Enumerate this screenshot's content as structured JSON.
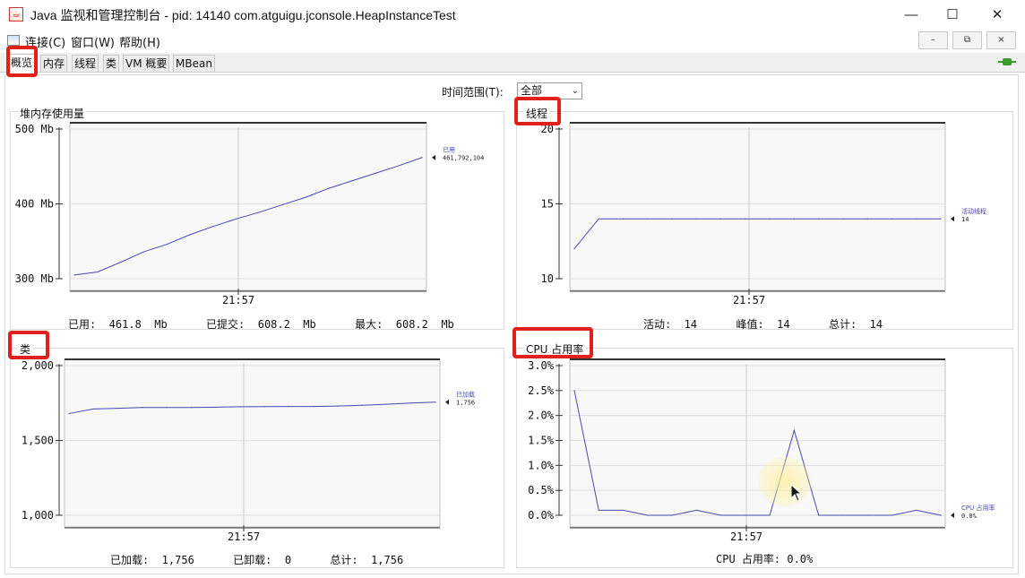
{
  "window": {
    "title": "Java 监视和管理控制台 - pid: 14140 com.atguigu.jconsole.HeapInstanceTest",
    "app_icon": "java-cup-icon",
    "controls": {
      "minimize": "—",
      "maximize": "☐",
      "close": "✕"
    }
  },
  "menu": [
    {
      "label": "连接(C)"
    },
    {
      "label": "窗口(W)"
    },
    {
      "label": "帮助(H)"
    }
  ],
  "inner_controls": {
    "minimize": "–",
    "restore": "⧉",
    "close": "×"
  },
  "tabs": [
    {
      "label": "概览",
      "active": true
    },
    {
      "label": "内存",
      "active": false
    },
    {
      "label": "线程",
      "active": false
    },
    {
      "label": "类",
      "active": false
    },
    {
      "label": "VM 概要",
      "active": false
    },
    {
      "label": "MBean",
      "active": false
    }
  ],
  "time_range": {
    "label": "时间范围(T):",
    "value": "全部"
  },
  "panels": {
    "heap": {
      "title": "堆内存使用量",
      "stats": "已用:  461.8  Mb      已提交:  608.2  Mb      最大:  608.2  Mb",
      "legend": {
        "name": "已用",
        "value": "461,792,104"
      }
    },
    "threads": {
      "title": "线程",
      "stats": "活动:  14      峰值:  14      总计:  14",
      "legend": {
        "name": "活动线程",
        "value": "14"
      }
    },
    "classes": {
      "title": "类",
      "stats": "已加载:  1,756      已卸载:  0      总计:  1,756",
      "legend": {
        "name": "已加载",
        "value": "1,756"
      }
    },
    "cpu": {
      "title": "CPU 占用率",
      "stats": "CPU 占用率: 0.0%",
      "legend": {
        "name": "CPU 占用率",
        "value": "0.0%"
      }
    }
  },
  "chart_data": [
    {
      "type": "line",
      "title": "堆内存使用量",
      "ylabel": "",
      "ylim": [
        300,
        500
      ],
      "yticks": [
        "500 Mb",
        "400 Mb",
        "300 Mb"
      ],
      "xticks": [
        "21:57"
      ],
      "grid": true,
      "series": [
        {
          "name": "已用",
          "color": "#4848b0",
          "values": [
            305,
            309,
            322,
            336,
            346,
            359,
            370,
            380,
            389,
            399,
            409,
            421,
            431,
            441,
            451,
            462
          ]
        }
      ]
    },
    {
      "type": "line",
      "title": "线程",
      "ylim": [
        10,
        20
      ],
      "yticks": [
        "20",
        "15",
        "10"
      ],
      "xticks": [
        "21:57"
      ],
      "grid": true,
      "series": [
        {
          "name": "活动线程",
          "color": "#4848b0",
          "values": [
            12,
            14,
            14,
            14,
            14,
            14,
            14,
            14,
            14,
            14,
            14,
            14,
            14,
            14,
            14,
            14
          ]
        }
      ]
    },
    {
      "type": "line",
      "title": "类",
      "ylim": [
        1000,
        2000
      ],
      "yticks": [
        "2,000",
        "1,500",
        "1,000"
      ],
      "xticks": [
        "21:57"
      ],
      "grid": true,
      "series": [
        {
          "name": "已加载",
          "color": "#4848b0",
          "values": [
            1680,
            1710,
            1715,
            1720,
            1720,
            1720,
            1722,
            1725,
            1726,
            1727,
            1727,
            1730,
            1735,
            1742,
            1750,
            1756
          ]
        }
      ]
    },
    {
      "type": "line",
      "title": "CPU 占用率",
      "ylim": [
        0,
        3
      ],
      "yticks": [
        "3.0%",
        "2.5%",
        "2.0%",
        "1.5%",
        "1.0%",
        "0.5%",
        "0.0%"
      ],
      "xticks": [
        "21:57"
      ],
      "grid": true,
      "series": [
        {
          "name": "CPU 占用率",
          "color": "#4848b0",
          "values": [
            2.5,
            0.1,
            0.1,
            0.0,
            0.0,
            0.1,
            0.0,
            0.0,
            0.0,
            1.7,
            0.0,
            0.0,
            0.0,
            0.0,
            0.1,
            0.0
          ]
        }
      ]
    }
  ]
}
